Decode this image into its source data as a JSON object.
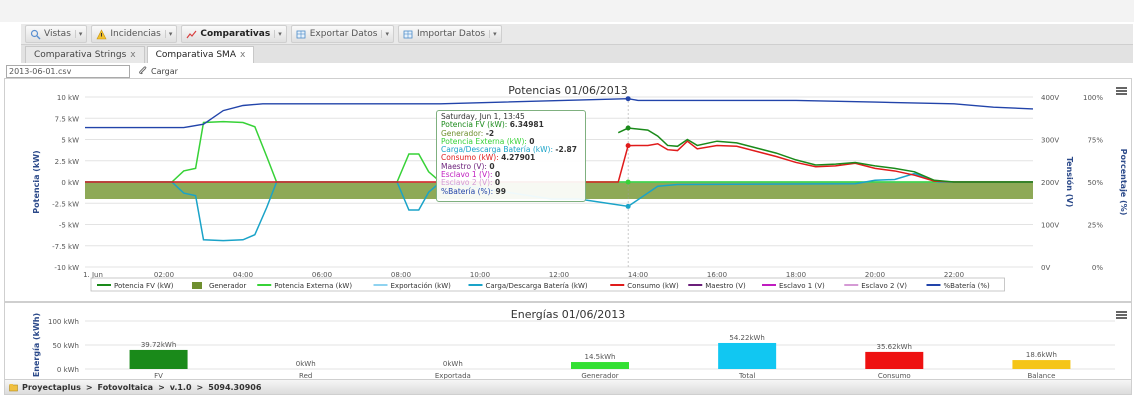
{
  "menu": [
    {
      "label": "Vistas",
      "icon": "search-icon",
      "active": false
    },
    {
      "label": "Incidencias",
      "icon": "warning-icon",
      "active": false
    },
    {
      "label": "Comparativas",
      "icon": "chart-line-icon",
      "active": true
    },
    {
      "label": "Exportar Datos",
      "icon": "table-export-icon",
      "active": false
    },
    {
      "label": "Importar Datos",
      "icon": "table-import-icon",
      "active": false
    }
  ],
  "tabs": [
    {
      "label": "Comparativa Strings",
      "close": "x",
      "active": false
    },
    {
      "label": "Comparativa SMA",
      "close": "x",
      "active": true
    }
  ],
  "file": {
    "value": "2013-06-01.csv",
    "load_label": "Cargar"
  },
  "top_chart_title": "Potencias 01/06/2013",
  "bottom_chart_title": "Energías 01/06/2013",
  "tooltip": {
    "header": "Saturday, Jun 1, 13:45",
    "rows": [
      {
        "label": "Potencia FV (kW)",
        "value": "6.34981",
        "color": "#1a8a1a"
      },
      {
        "label": "Generador",
        "value": "-2",
        "color": "#6f8f2f"
      },
      {
        "label": "Potencia Externa (kW)",
        "value": "0",
        "color": "#37d237"
      },
      {
        "label": "Carga/Descarga Batería (kW)",
        "value": "-2.87",
        "color": "#1aa3c8"
      },
      {
        "label": "Consumo (kW)",
        "value": "4.27901",
        "color": "#e01b1b"
      },
      {
        "label": "Maestro (V)",
        "value": "0",
        "color": "#6b1f7a"
      },
      {
        "label": "Esclavo 1 (V)",
        "value": "0",
        "color": "#c01cc0"
      },
      {
        "label": "Esclavo 2 (V)",
        "value": "0",
        "color": "#d59ad5"
      },
      {
        "label": "%Batería (%)",
        "value": "99",
        "color": "#2244aa"
      }
    ]
  },
  "status": {
    "crumbs": [
      "Proyectaplus",
      "Fotovoltaica",
      "v.1.0",
      "5094.30906"
    ],
    "separator": ">"
  },
  "chart_data": [
    {
      "type": "line",
      "title": "Potencias 01/06/2013",
      "xlabel": "",
      "ylabel": "Potencia (kW)",
      "ylabel_right_1": "Tensión (V)",
      "ylabel_right_2": "Porcentaje (%)",
      "x_ticks": [
        "1. Jun",
        "02:00",
        "04:00",
        "06:00",
        "08:00",
        "10:00",
        "12:00",
        "14:00",
        "16:00",
        "18:00",
        "20:00",
        "22:00"
      ],
      "y_ticks": [
        "10 kW",
        "7.5 kW",
        "5 kW",
        "2.5 kW",
        "0 kW",
        "-2.5 kW",
        "-5 kW",
        "-7.5 kW",
        "-10 kW"
      ],
      "y_right1_ticks": [
        "400V",
        "300V",
        "200V",
        "100V",
        "0V"
      ],
      "y_right2_ticks": [
        "100%",
        "75%",
        "50%",
        "25%",
        "0%"
      ],
      "ylim": [
        -10,
        10
      ],
      "xlim_hours": [
        0,
        24
      ],
      "series": [
        {
          "name": "Potencia FV (kW)",
          "color": "#1a8a1a",
          "points": [
            [
              13.5,
              5.8
            ],
            [
              13.75,
              6.35
            ],
            [
              14.25,
              6.1
            ],
            [
              14.5,
              5.4
            ],
            [
              14.75,
              4.3
            ],
            [
              15.0,
              4.2
            ],
            [
              15.25,
              5.0
            ],
            [
              15.5,
              4.3
            ],
            [
              16,
              4.8
            ],
            [
              16.5,
              4.6
            ],
            [
              17,
              4.0
            ],
            [
              17.5,
              3.4
            ],
            [
              18,
              2.6
            ],
            [
              18.5,
              2.0
            ],
            [
              19,
              2.1
            ],
            [
              19.5,
              2.3
            ],
            [
              20,
              1.9
            ],
            [
              20.5,
              1.6
            ],
            [
              21,
              1.2
            ],
            [
              21.5,
              0.2
            ],
            [
              22,
              0
            ],
            [
              24,
              0
            ]
          ]
        },
        {
          "name": "Generador",
          "color": "#6f8f2f",
          "area": true,
          "y_from": 0,
          "y_to": -2,
          "x_start": 0,
          "x_end": 24
        },
        {
          "name": "Potencia Externa (kW)",
          "color": "#37d237",
          "points": [
            [
              0,
              0
            ],
            [
              2.2,
              0
            ],
            [
              2.5,
              1.3
            ],
            [
              2.8,
              1.6
            ],
            [
              3.0,
              7.0
            ],
            [
              3.5,
              7.1
            ],
            [
              4.0,
              7.0
            ],
            [
              4.3,
              6.5
            ],
            [
              4.6,
              3.0
            ],
            [
              4.85,
              0
            ],
            [
              7.9,
              0
            ],
            [
              8.2,
              3.3
            ],
            [
              8.45,
              3.3
            ],
            [
              8.7,
              1.2
            ],
            [
              9.0,
              0
            ],
            [
              13.6,
              0
            ],
            [
              13.7,
              0
            ],
            [
              24,
              0
            ]
          ]
        },
        {
          "name": "Exportación (kW)",
          "color": "#8fd3f0",
          "points": [
            [
              0,
              0
            ],
            [
              24,
              0
            ]
          ]
        },
        {
          "name": "Carga/Descarga Batería (kW)",
          "color": "#1aa3c8",
          "points": [
            [
              0,
              0
            ],
            [
              2.2,
              0
            ],
            [
              2.5,
              -1.3
            ],
            [
              2.8,
              -1.6
            ],
            [
              3.0,
              -6.8
            ],
            [
              3.5,
              -6.9
            ],
            [
              4.0,
              -6.8
            ],
            [
              4.3,
              -6.2
            ],
            [
              4.6,
              -3.0
            ],
            [
              4.85,
              0
            ],
            [
              7.9,
              0
            ],
            [
              8.2,
              -3.3
            ],
            [
              8.45,
              -3.3
            ],
            [
              8.7,
              -1.2
            ],
            [
              9.0,
              0
            ],
            [
              11.8,
              -2.0
            ],
            [
              12.5,
              -2.0
            ],
            [
              13.75,
              -2.87
            ],
            [
              14.5,
              -0.5
            ],
            [
              15,
              -0.3
            ],
            [
              19.5,
              -0.2
            ],
            [
              20,
              0.2
            ],
            [
              20.5,
              0.3
            ],
            [
              21,
              1.0
            ],
            [
              21.3,
              0.5
            ],
            [
              21.6,
              0
            ],
            [
              24,
              0
            ]
          ]
        },
        {
          "name": "Consumo (kW)",
          "color": "#e01b1b",
          "points": [
            [
              0,
              0
            ],
            [
              13.5,
              0
            ],
            [
              13.75,
              4.28
            ],
            [
              14.25,
              4.3
            ],
            [
              14.5,
              4.5
            ],
            [
              14.75,
              3.8
            ],
            [
              15.0,
              3.7
            ],
            [
              15.25,
              4.8
            ],
            [
              15.5,
              3.9
            ],
            [
              16,
              4.3
            ],
            [
              16.5,
              4.2
            ],
            [
              17,
              3.6
            ],
            [
              17.5,
              3.0
            ],
            [
              18,
              2.3
            ],
            [
              18.5,
              1.8
            ],
            [
              19,
              1.9
            ],
            [
              19.5,
              2.2
            ],
            [
              20,
              1.6
            ],
            [
              20.5,
              1.3
            ],
            [
              21,
              0.8
            ],
            [
              21.5,
              0.1
            ],
            [
              22,
              0
            ],
            [
              24,
              0
            ]
          ]
        },
        {
          "name": "Maestro (V)",
          "color": "#6b1f7a",
          "points": []
        },
        {
          "name": "Esclavo 1 (V)",
          "color": "#c01cc0",
          "points": []
        },
        {
          "name": "Esclavo 2 (V)",
          "color": "#d59ad5",
          "points": []
        },
        {
          "name": "%Batería (%)",
          "color": "#2244aa",
          "axis": "percent",
          "points": [
            [
              0,
              82
            ],
            [
              1,
              82
            ],
            [
              2.5,
              82
            ],
            [
              3,
              84
            ],
            [
              3.5,
              92
            ],
            [
              4,
              95
            ],
            [
              4.5,
              96
            ],
            [
              5,
              96
            ],
            [
              8,
              96
            ],
            [
              9,
              96
            ],
            [
              13.75,
              99
            ],
            [
              14,
              98
            ],
            [
              18,
              98
            ],
            [
              20,
              97
            ],
            [
              22,
              96
            ],
            [
              23,
              94
            ],
            [
              24,
              93
            ]
          ]
        }
      ],
      "legend": [
        "Potencia FV (kW)",
        "Generador",
        "Potencia Externa (kW)",
        "Exportación (kW)",
        "Carga/Descarga Batería (kW)",
        "Consumo (kW)",
        "Maestro (V)",
        "Esclavo 1 (V)",
        "Esclavo 2 (V)",
        "%Batería (%)"
      ],
      "legend_position": "bottom"
    },
    {
      "type": "bar",
      "title": "Energías 01/06/2013",
      "ylabel": "Energía (kWh)",
      "y_ticks": [
        "100 kWh",
        "50 kWh",
        "0 kWh"
      ],
      "ylim": [
        0,
        100
      ],
      "categories": [
        "FV",
        "Red",
        "Exportada",
        "Generador",
        "Total",
        "Consumo",
        "Balance"
      ],
      "values": [
        39.72,
        0,
        0,
        14.5,
        54.22,
        35.62,
        18.6
      ],
      "data_labels": [
        "39.72kWh",
        "0kWh",
        "0kWh",
        "14.5kWh",
        "54.22kWh",
        "35.62kWh",
        "18.6kWh"
      ],
      "colors": [
        "#1a8a1a",
        "#1a8a1a",
        "#1a8a1a",
        "#33e033",
        "#11c7f2",
        "#ee1111",
        "#f5c518"
      ]
    }
  ]
}
